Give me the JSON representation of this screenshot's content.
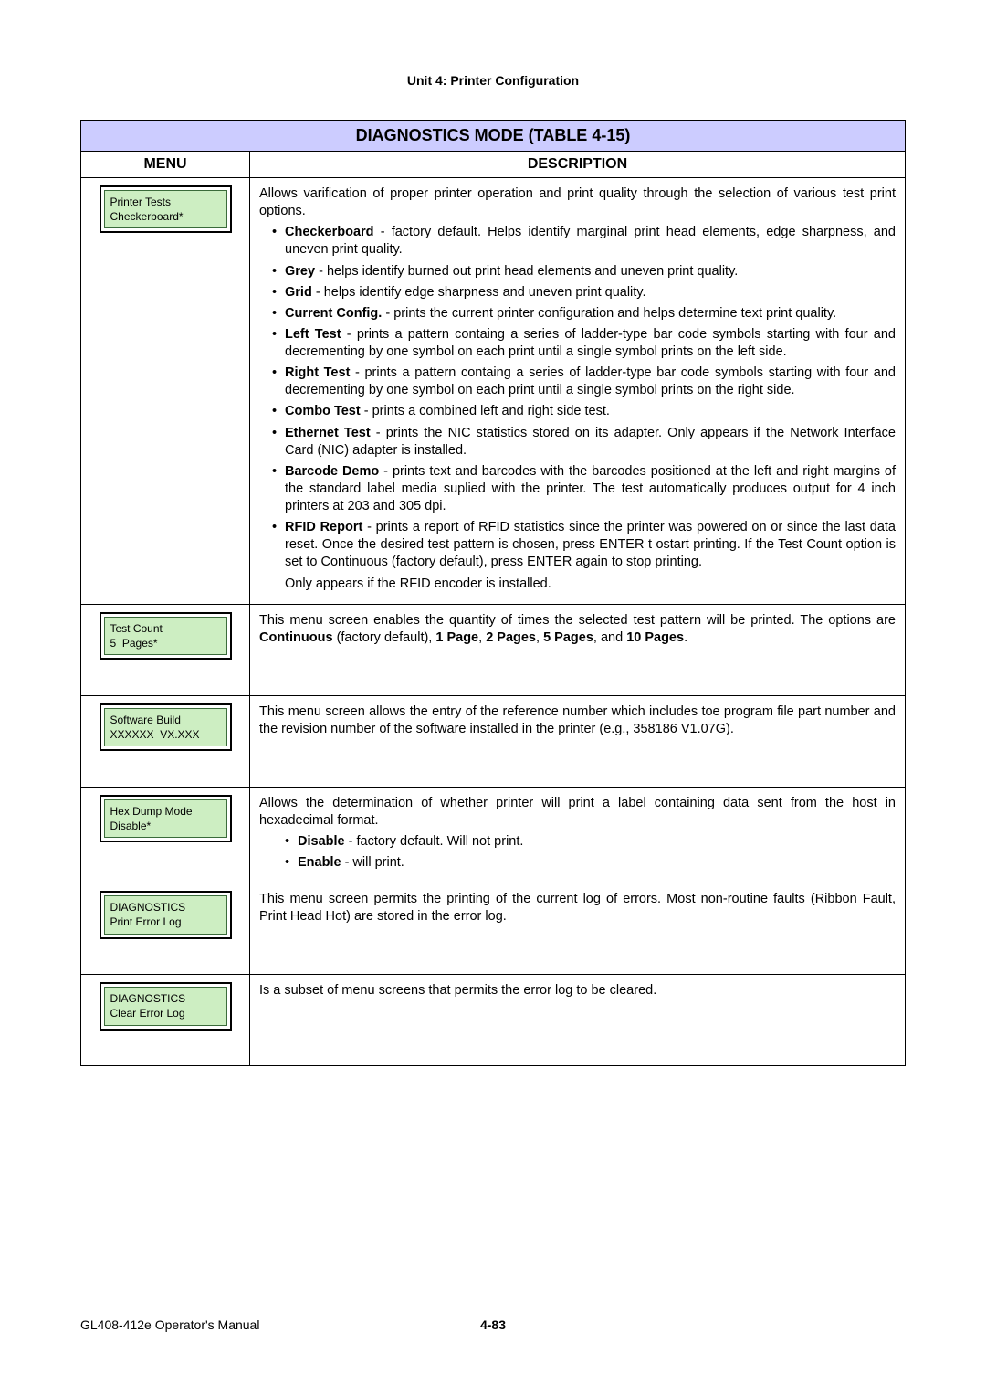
{
  "unit_header": "Unit 4:  Printer Configuration",
  "table_title": "DIAGNOSTICS MODE (TABLE 4-15)",
  "col_menu": "MENU",
  "col_desc": "DESCRIPTION",
  "rows": [
    {
      "lcd1": "Printer Tests",
      "lcd2": "Checkerboard*",
      "intro": "Allows varification of proper printer operation and print quality through the selection of various test print options.",
      "bullets": [
        {
          "b": "Checkerboard",
          "t": " - factory default. Helps identify marginal print head elements, edge sharpness, and uneven print quality."
        },
        {
          "b": "Grey",
          "t": " -  helps identify burned out print head elements and uneven print quality."
        },
        {
          "b": "Grid",
          "t": " - helps identify edge sharpness and uneven print quality."
        },
        {
          "b": "Current Config.",
          "t": " - prints the current printer configuration and helps determine text print quality."
        },
        {
          "b": "Left Test",
          "t": " - prints a pattern containg a series of ladder-type bar code symbols starting with four and decrementing by one symbol on each print until a single symbol prints on the left side."
        },
        {
          "b": "Right Test",
          "t": " - prints a pattern containg a series of ladder-type bar code symbols starting with four and decrementing by one symbol on each print until a single symbol prints on the right side."
        },
        {
          "b": "Combo Test",
          "t": " - prints a combined left and right side test."
        },
        {
          "b": "Ethernet Test",
          "t": " - prints the NIC statistics stored on its adapter. Only appears if the Network Interface Card (NIC) adapter is installed."
        },
        {
          "b": "Barcode Demo",
          "t": " - prints text and barcodes with the barcodes positioned at the left and right margins of the standard label media suplied with the printer. The test automatically produces output for 4 inch printers at 203 and 305 dpi."
        },
        {
          "b": "RFID Report",
          "t": " - prints a report of RFID statistics since the printer was powered on or since the last data reset. Once the desired test pattern is chosen, press ENTER t ostart printing. If the Test Count option is set to Continuous (factory default), press ENTER again to stop printing."
        }
      ],
      "outro": "Only appears if the RFID encoder is installed."
    },
    {
      "lcd1": "Test Count",
      "lcd2": "5  Pages*",
      "desc_pre": "This menu screen enables the quantity of times the selected test pattern will be printed. The options are ",
      "desc_bold_parts": [
        "Continuous",
        " (factory default), ",
        "1 Page",
        ", ",
        "2 Pages",
        ", ",
        "5 Pages",
        ", and ",
        "10 Pages",
        "."
      ]
    },
    {
      "lcd1": "Software Build",
      "lcd2": "XXXXXX  VX.XXX",
      "desc_plain": "This menu screen allows the entry of the reference number which includes toe program file part number and the revision number of the software installed in the printer (e.g., 358186 V1.07G)."
    },
    {
      "lcd1": "Hex Dump Mode",
      "lcd2": "Disable*",
      "intro": "Allows the determination of whether printer will print a label containing data sent from the host in hexadecimal format.",
      "nested_bullets": [
        {
          "b": "Disable",
          "t": " - factory default. Will not print."
        },
        {
          "b": "Enable",
          "t": " - will print."
        }
      ]
    },
    {
      "lcd1": "DIAGNOSTICS",
      "lcd2": "Print Error Log",
      "desc_plain": "This menu screen permits the printing of the current log of errors. Most non-routine faults (Ribbon Fault, Print Head Hot) are stored in the error log."
    },
    {
      "lcd1": "DIAGNOSTICS",
      "lcd2": "Clear Error Log",
      "desc_plain": "Is a subset of menu screens that permits the error log to be cleared."
    }
  ],
  "footer_left": "GL408-412e Operator's Manual",
  "footer_center": "4-83"
}
